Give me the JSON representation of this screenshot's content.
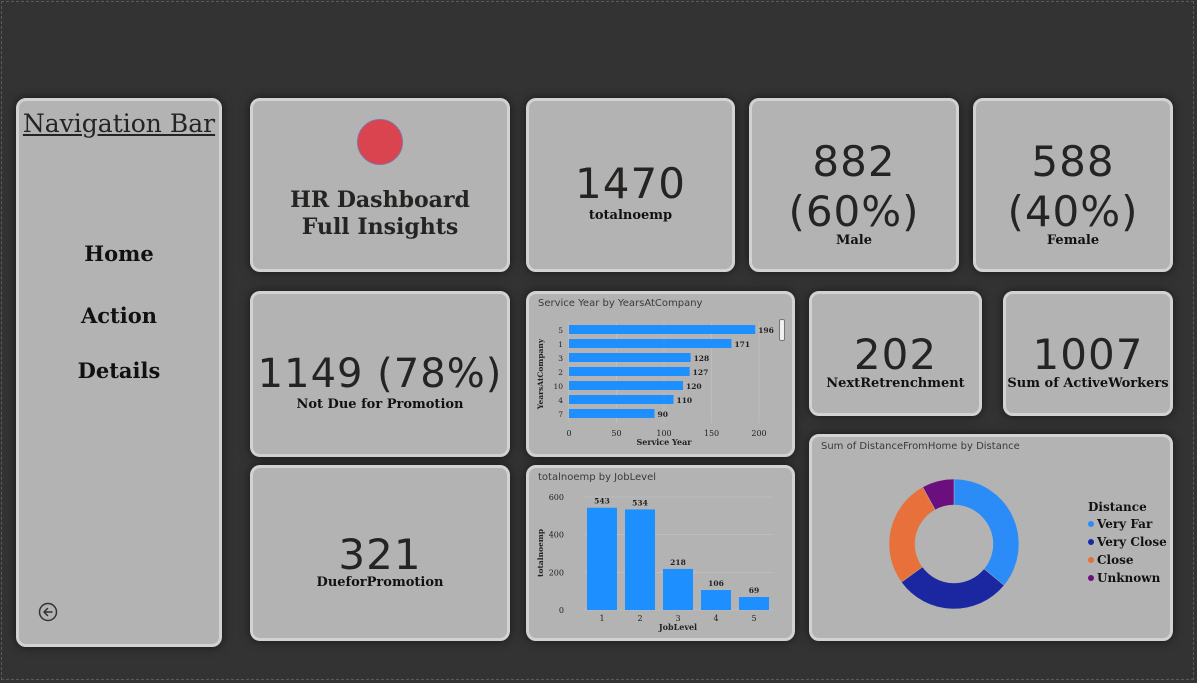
{
  "nav": {
    "title": "Navigation Bar",
    "items": [
      {
        "label": "Home"
      },
      {
        "label": "Action"
      },
      {
        "label": "Details"
      }
    ],
    "back_icon": "circle-arrow-left-icon"
  },
  "header": {
    "title_line1": "HR Dashboard",
    "title_line2": "Full Insights",
    "logo_color": "#d9444f"
  },
  "kpis": {
    "total": {
      "value": "1470",
      "label": "totalnoemp"
    },
    "male": {
      "value_line1": "882",
      "value_line2": "(60%)",
      "label": "Male"
    },
    "female": {
      "value_line1": "588",
      "value_line2": "(40%)",
      "label": "Female"
    },
    "not_due": {
      "value": "1149 (78%)",
      "label": "Not Due for Promotion"
    },
    "due": {
      "value": "321",
      "label": "DueforPromotion"
    },
    "retrenchment": {
      "value": "202",
      "label": "NextRetrenchment"
    },
    "active": {
      "value": "1007",
      "label": "Sum of ActiveWorkers"
    }
  },
  "colors": {
    "background": "#333333",
    "card": "#b3b3b3",
    "bar": "#1e8fff",
    "very_far": "#2b8cf7",
    "very_close": "#1a27a0",
    "close": "#e8703a",
    "unknown": "#6b0f7f"
  },
  "chart_data": [
    {
      "type": "bar",
      "orientation": "horizontal",
      "title": "Service Year by YearsAtCompany",
      "xlabel": "Service Year",
      "ylabel": "YearsAtCompany",
      "categories": [
        "5",
        "1",
        "3",
        "2",
        "10",
        "4",
        "7"
      ],
      "values": [
        196,
        171,
        128,
        127,
        120,
        110,
        90
      ],
      "xticks": [
        "0",
        "50",
        "100",
        "150",
        "200"
      ],
      "xlim": [
        0,
        200
      ]
    },
    {
      "type": "bar",
      "orientation": "vertical",
      "title": "totalnoemp by JobLevel",
      "xlabel": "JobLevel",
      "ylabel": "totalnoemp",
      "categories": [
        "1",
        "2",
        "3",
        "4",
        "5"
      ],
      "values": [
        543,
        534,
        218,
        106,
        69
      ],
      "yticks": [
        "0",
        "200",
        "400",
        "600"
      ],
      "ylim": [
        0,
        600
      ]
    },
    {
      "type": "pie",
      "donut": true,
      "title": "Sum of DistanceFromHome by Distance",
      "legend_title": "Distance",
      "legend_placement": "right",
      "categories": [
        "Very Far",
        "Very Close",
        "Close",
        "Unknown"
      ],
      "values": [
        36,
        29,
        27,
        8
      ]
    }
  ]
}
